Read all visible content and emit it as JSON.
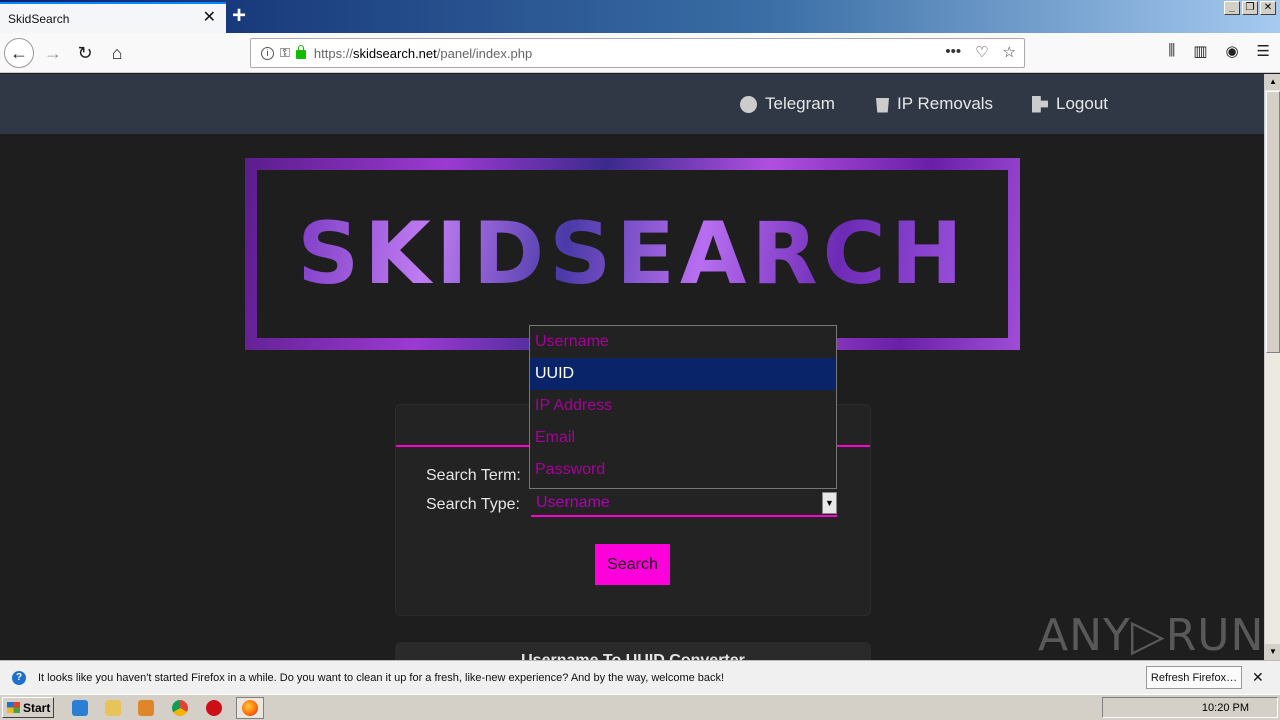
{
  "browser": {
    "tab_title": "SkidSearch",
    "tab_close": "✕",
    "new_tab": "+",
    "url_prefix": "https://",
    "url_host": "skidsearch.net",
    "url_path": "/panel/index.php",
    "page_actions": "•••"
  },
  "nav": {
    "telegram": "Telegram",
    "ip_removals": "IP Removals",
    "logout": "Logout"
  },
  "banner": {
    "title": "SKIDSEARCH"
  },
  "form": {
    "search_term_label": "Search Term:",
    "search_type_label": "Search Type:",
    "search_type_value": "Username",
    "search_button": "Search"
  },
  "dropdown": {
    "options": [
      "Username",
      "UUID",
      "IP Address",
      "Email",
      "Password"
    ],
    "highlighted": "UUID"
  },
  "converter": {
    "title": "Username To UUID Converter"
  },
  "watermark": "ANY▷RUN",
  "notification": {
    "text": "It looks like you haven't started Firefox in a while. Do you want to clean it up for a fresh, like-new experience? And by the way, welcome back!",
    "button": "Refresh Firefox…",
    "close": "✕"
  },
  "taskbar": {
    "start": "Start",
    "time": "10:20 PM"
  },
  "colors": {
    "accent": "#ff00cc",
    "nav_bg": "#303846",
    "page_bg": "#1e1e1e",
    "option_text": "#a8009a",
    "highlight": "#0a246a"
  }
}
